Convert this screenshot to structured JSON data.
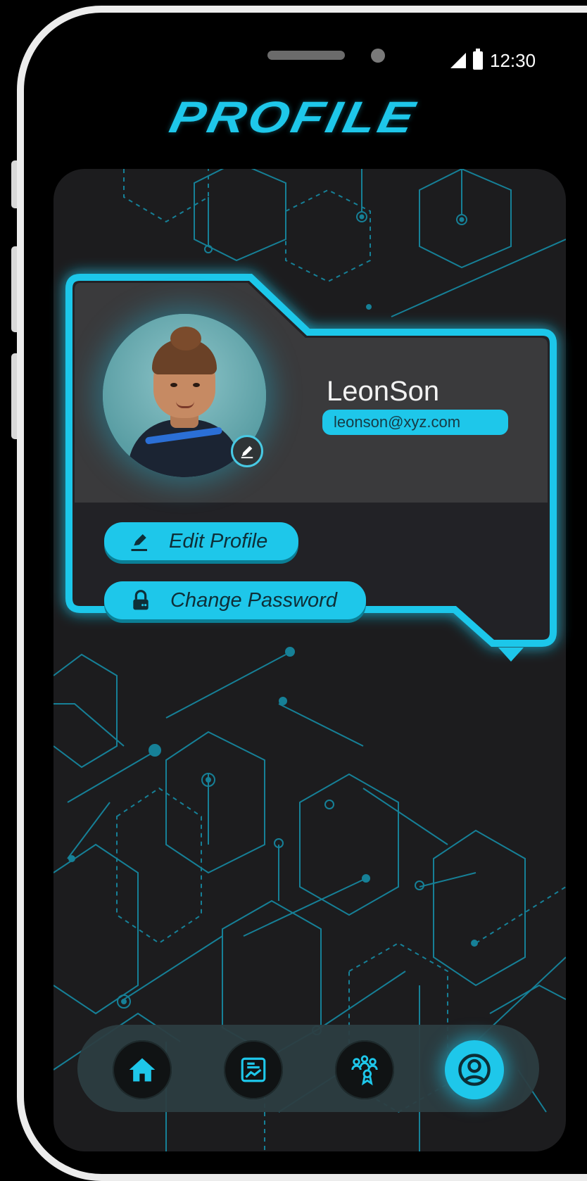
{
  "status_bar": {
    "time": "12:30",
    "icons": [
      "signal-icon",
      "battery-icon"
    ]
  },
  "header": {
    "title": "PROFILE"
  },
  "profile": {
    "name": "LeonSon",
    "email": "leonson@xyz.com",
    "avatar_icon": "user-photo",
    "edit_avatar_icon": "pencil-icon"
  },
  "actions": [
    {
      "label": "Edit Profile",
      "icon": "pencil-icon"
    },
    {
      "label": "Change Password",
      "icon": "lock-icon"
    }
  ],
  "bottom_nav": {
    "items": [
      {
        "icon": "home-icon",
        "active": false
      },
      {
        "icon": "dashboard-icon",
        "active": false
      },
      {
        "icon": "team-icon",
        "active": false
      },
      {
        "icon": "profile-icon",
        "active": true
      }
    ]
  },
  "colors": {
    "accent": "#1ec7ea",
    "panel": "#1c1c1e",
    "card": "#3a3a3c",
    "background": "#000000"
  }
}
